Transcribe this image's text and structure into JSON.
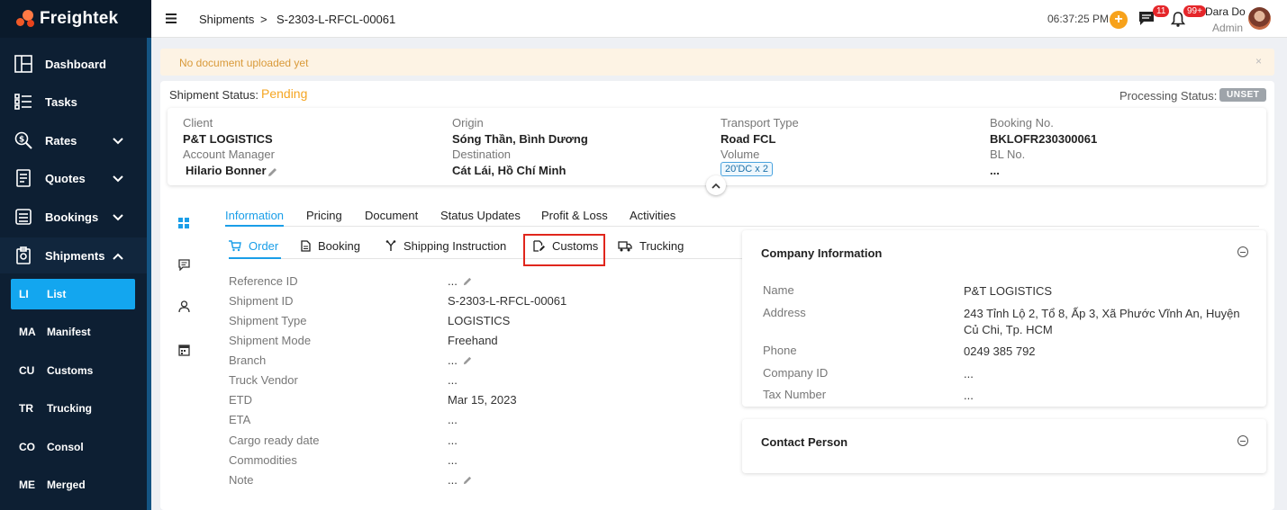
{
  "app": {
    "name": "Freightek"
  },
  "sidebar": {
    "items": [
      {
        "label": "Dashboard"
      },
      {
        "label": "Tasks"
      },
      {
        "label": "Rates"
      },
      {
        "label": "Quotes"
      },
      {
        "label": "Bookings"
      },
      {
        "label": "Shipments"
      }
    ],
    "sub_items": [
      {
        "abbr": "LI",
        "label": "List",
        "active": true
      },
      {
        "abbr": "MA",
        "label": "Manifest"
      },
      {
        "abbr": "CU",
        "label": "Customs"
      },
      {
        "abbr": "TR",
        "label": "Trucking"
      },
      {
        "abbr": "CO",
        "label": "Consol"
      },
      {
        "abbr": "ME",
        "label": "Merged"
      }
    ]
  },
  "header": {
    "breadcrumb_root": "Shipments",
    "breadcrumb_sep": ">",
    "breadcrumb_current": "S-2303-L-RFCL-00061",
    "time": "06:37:25 PM",
    "plus": "+",
    "chat_badge": "11",
    "bell_badge": "99+",
    "user_name": "Dara Do",
    "user_role": "Admin"
  },
  "alert": {
    "text": "No document uploaded yet",
    "close": "×"
  },
  "status": {
    "label": "Shipment Status:",
    "value": "Pending",
    "processing_label": "Processing Status:",
    "processing_value": "UNSET"
  },
  "summary": {
    "client_label": "Client",
    "client": "P&T LOGISTICS",
    "manager_label": "Account Manager",
    "manager": "Hilario Bonner",
    "origin_label": "Origin",
    "origin": "Sóng Thần, Bình Dương",
    "destination_label": "Destination",
    "destination": "Cát Lái, Hồ Chí Minh",
    "transport_label": "Transport Type",
    "transport": "Road FCL",
    "volume_label": "Volume",
    "volume": "20'DC x 2",
    "booking_label": "Booking No.",
    "booking": "BKLOFR230300061",
    "bl_label": "BL No.",
    "bl": "..."
  },
  "tabs": [
    "Information",
    "Pricing",
    "Document",
    "Status Updates",
    "Profit & Loss",
    "Activities"
  ],
  "subtabs": [
    "Order",
    "Booking",
    "Shipping Instruction",
    "Customs",
    "Trucking"
  ],
  "fields": [
    {
      "label": "Reference ID",
      "value": "..."
    },
    {
      "label": "Shipment ID",
      "value": "S-2303-L-RFCL-00061"
    },
    {
      "label": "Shipment Type",
      "value": "LOGISTICS"
    },
    {
      "label": "Shipment Mode",
      "value": "Freehand"
    },
    {
      "label": "Branch",
      "value": "..."
    },
    {
      "label": "Truck Vendor",
      "value": "..."
    },
    {
      "label": "ETD",
      "value": "Mar 15, 2023"
    },
    {
      "label": "ETA",
      "value": "..."
    },
    {
      "label": "Cargo ready date",
      "value": "..."
    },
    {
      "label": "Commodities",
      "value": "..."
    },
    {
      "label": "Note",
      "value": "..."
    }
  ],
  "company": {
    "title": "Company Information",
    "rows": [
      {
        "label": "Name",
        "value": "P&T LOGISTICS"
      },
      {
        "label": "Address",
        "value": "243 Tỉnh Lộ 2, Tổ 8, Ấp 3, Xã Phước Vĩnh An, Huyện Củ Chi, Tp. HCM"
      },
      {
        "label": "Phone",
        "value": "0249 385 792"
      },
      {
        "label": "Company ID",
        "value": "..."
      },
      {
        "label": "Tax Number",
        "value": "..."
      }
    ]
  },
  "contact": {
    "title": "Contact Person"
  },
  "colors": {
    "sidebar_bg": "#0d1f33",
    "accent": "#1a9ee8",
    "pending": "#f5a623",
    "highlight": "#e0261c"
  }
}
